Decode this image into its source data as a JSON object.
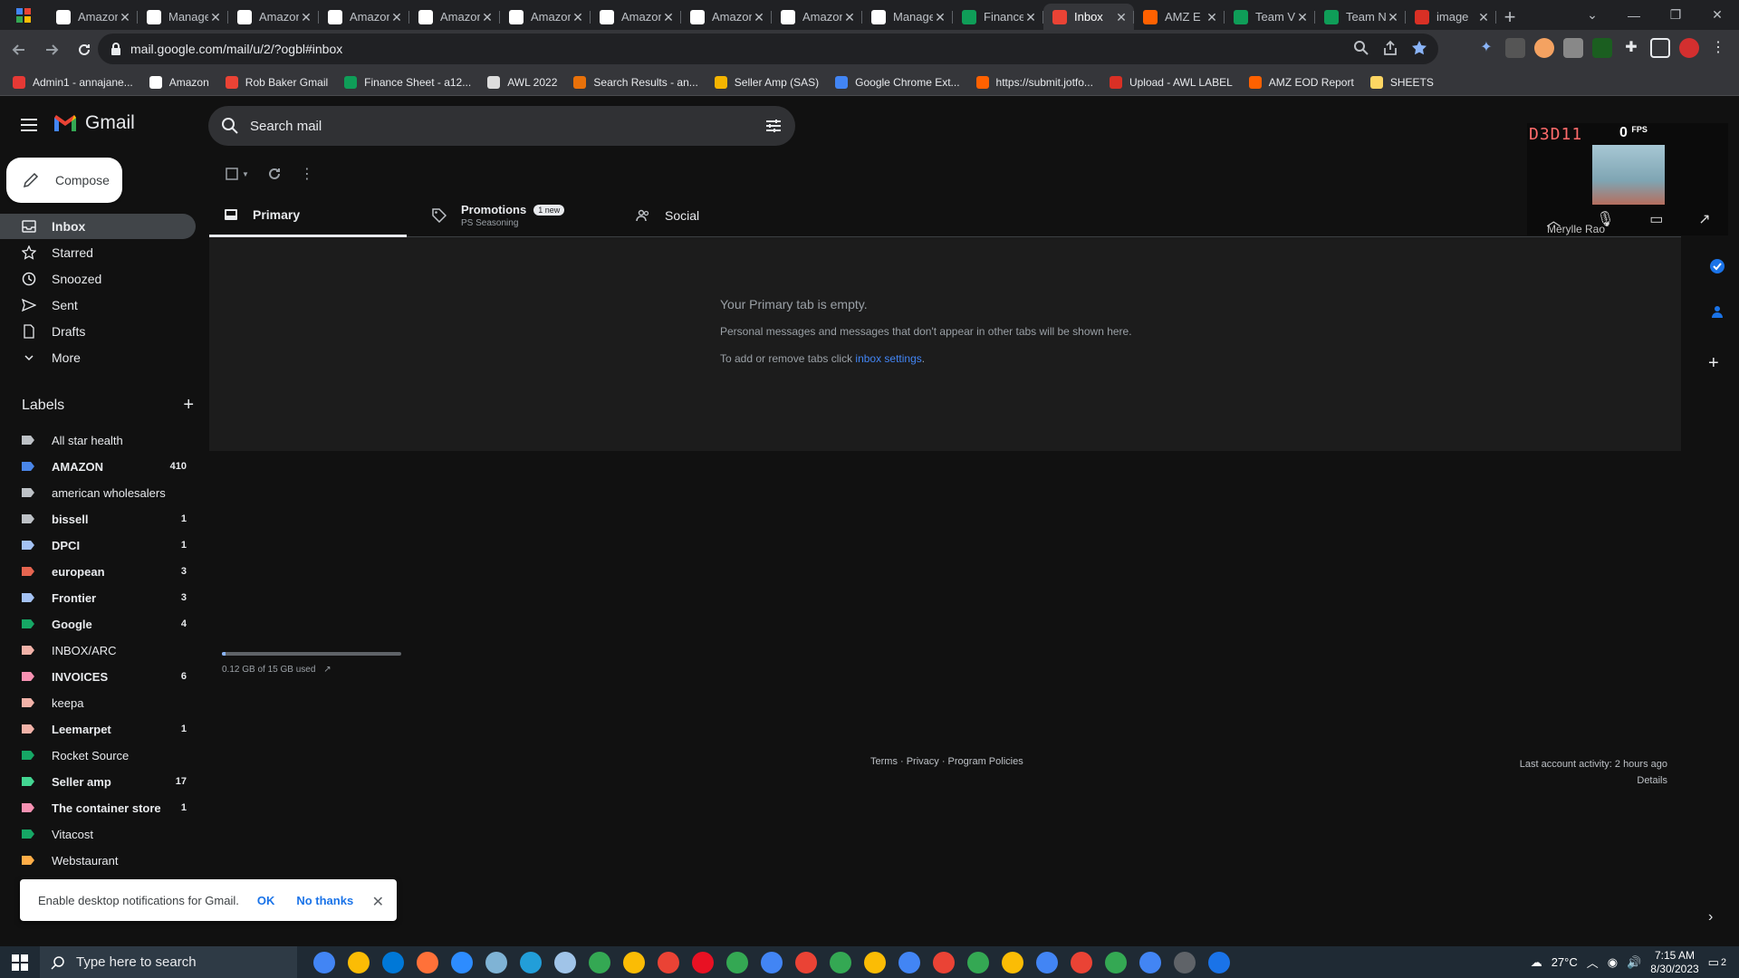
{
  "browser": {
    "tabs": [
      {
        "title": "Amazon",
        "icon": "amazon-icon",
        "active": false
      },
      {
        "title": "Manage",
        "icon": "amazon-icon",
        "active": false
      },
      {
        "title": "Amazon",
        "icon": "amazon-icon",
        "active": false
      },
      {
        "title": "Amazon",
        "icon": "amazon-icon",
        "active": false
      },
      {
        "title": "Amazon",
        "icon": "amazon-icon",
        "active": false
      },
      {
        "title": "Amazon",
        "icon": "amazon-icon",
        "active": false
      },
      {
        "title": "Amazon",
        "icon": "amazon-icon",
        "active": false
      },
      {
        "title": "Amazon",
        "icon": "amazon-icon",
        "active": false
      },
      {
        "title": "Amazon",
        "icon": "amazon-icon",
        "active": false
      },
      {
        "title": "Manage",
        "icon": "amazon-icon",
        "active": false
      },
      {
        "title": "Finance",
        "icon": "sheets-icon",
        "active": false
      },
      {
        "title": "Inbox",
        "icon": "gmail-icon",
        "active": true
      },
      {
        "title": "AMZ E",
        "icon": "jotform-icon",
        "active": false
      },
      {
        "title": "Team V",
        "icon": "sheets-icon",
        "active": false
      },
      {
        "title": "Team N",
        "icon": "sheets-icon",
        "active": false
      },
      {
        "title": "image",
        "icon": "image-icon",
        "active": false
      }
    ],
    "url": "mail.google.com/mail/u/2/?ogbl#inbox",
    "bookmarks": [
      {
        "label": "Admin1 - annajane...",
        "color": "#e53935"
      },
      {
        "label": "Amazon",
        "color": "#ffffff"
      },
      {
        "label": "Rob Baker Gmail",
        "color": "#ea4335"
      },
      {
        "label": "Finance Sheet - a12...",
        "color": "#0f9d58"
      },
      {
        "label": "AWL 2022",
        "color": "#dddddd"
      },
      {
        "label": "Search Results - an...",
        "color": "#e8710a"
      },
      {
        "label": "Seller Amp (SAS)",
        "color": "#f4b400"
      },
      {
        "label": "Google Chrome Ext...",
        "color": "#4285f4"
      },
      {
        "label": "https://submit.jotfo...",
        "color": "#ff6100"
      },
      {
        "label": "Upload - AWL LABEL",
        "color": "#d93025"
      },
      {
        "label": "AMZ EOD Report",
        "color": "#ff6100"
      },
      {
        "label": "SHEETS",
        "color": "#fdd663"
      }
    ]
  },
  "gmail": {
    "logo_text": "Gmail",
    "search_placeholder": "Search mail",
    "compose_label": "Compose",
    "nav": [
      {
        "label": "Inbox",
        "icon": "inbox-icon",
        "active": true
      },
      {
        "label": "Starred",
        "icon": "star-icon",
        "active": false
      },
      {
        "label": "Snoozed",
        "icon": "clock-icon",
        "active": false
      },
      {
        "label": "Sent",
        "icon": "send-icon",
        "active": false
      },
      {
        "label": "Drafts",
        "icon": "draft-icon",
        "active": false
      },
      {
        "label": "More",
        "icon": "chevron-down-icon",
        "active": false
      }
    ],
    "labels_heading": "Labels",
    "labels": [
      {
        "name": "All star health",
        "count": "",
        "color": "#bdc1c6",
        "bold": false
      },
      {
        "name": "AMAZON",
        "count": "410",
        "color": "#4a86e8",
        "bold": true
      },
      {
        "name": "american wholesalers",
        "count": "",
        "color": "#bdc1c6",
        "bold": false
      },
      {
        "name": "bissell",
        "count": "1",
        "color": "#bdc1c6",
        "bold": true
      },
      {
        "name": "DPCI",
        "count": "1",
        "color": "#a4c2f4",
        "bold": true
      },
      {
        "name": "european",
        "count": "3",
        "color": "#e66550",
        "bold": true
      },
      {
        "name": "Frontier",
        "count": "3",
        "color": "#a4c2f4",
        "bold": true
      },
      {
        "name": "Google",
        "count": "4",
        "color": "#16a765",
        "bold": true
      },
      {
        "name": "INBOX/ARC",
        "count": "",
        "color": "#f2b2a8",
        "bold": false
      },
      {
        "name": "INVOICES",
        "count": "6",
        "color": "#f691b2",
        "bold": true
      },
      {
        "name": "keepa",
        "count": "",
        "color": "#f2b2a8",
        "bold": false
      },
      {
        "name": "Leemarpet",
        "count": "1",
        "color": "#f2b2a8",
        "bold": true
      },
      {
        "name": "Rocket Source",
        "count": "",
        "color": "#16a765",
        "bold": false
      },
      {
        "name": "Seller amp",
        "count": "17",
        "color": "#43d692",
        "bold": true
      },
      {
        "name": "The container store",
        "count": "1",
        "color": "#f691b2",
        "bold": true
      },
      {
        "name": "Vitacost",
        "count": "",
        "color": "#16a765",
        "bold": false
      },
      {
        "name": "Webstaurant",
        "count": "",
        "color": "#ffad47",
        "bold": false
      }
    ],
    "tabs": {
      "primary": "Primary",
      "promotions": "Promotions",
      "promotions_badge": "1 new",
      "promotions_sub": "PS Seasoning",
      "social": "Social"
    },
    "empty": {
      "title": "Your Primary tab is empty.",
      "desc": "Personal messages and messages that don't appear in other tabs will be shown here.",
      "settings_prefix": "To add or remove tabs click ",
      "settings_link": "inbox settings",
      "settings_suffix": "."
    },
    "storage": {
      "text": "0.12 GB of 15 GB used",
      "fraction": 0.008
    },
    "footer_links": "Terms · Privacy · Program Policies",
    "activity": "Last account activity: 2 hours ago",
    "details": "Details",
    "notification": {
      "text": "Enable desktop notifications for Gmail.",
      "ok": "OK",
      "no": "No thanks"
    }
  },
  "video_overlay": {
    "hud_text": "D3D11",
    "fps_value": "0",
    "fps_label": "FPS",
    "name": "Merylle Rao"
  },
  "taskbar": {
    "search_placeholder": "Type here to search",
    "temperature": "27°C",
    "time": "7:15 AM",
    "date": "8/30/2023",
    "notifications_count": "2"
  }
}
